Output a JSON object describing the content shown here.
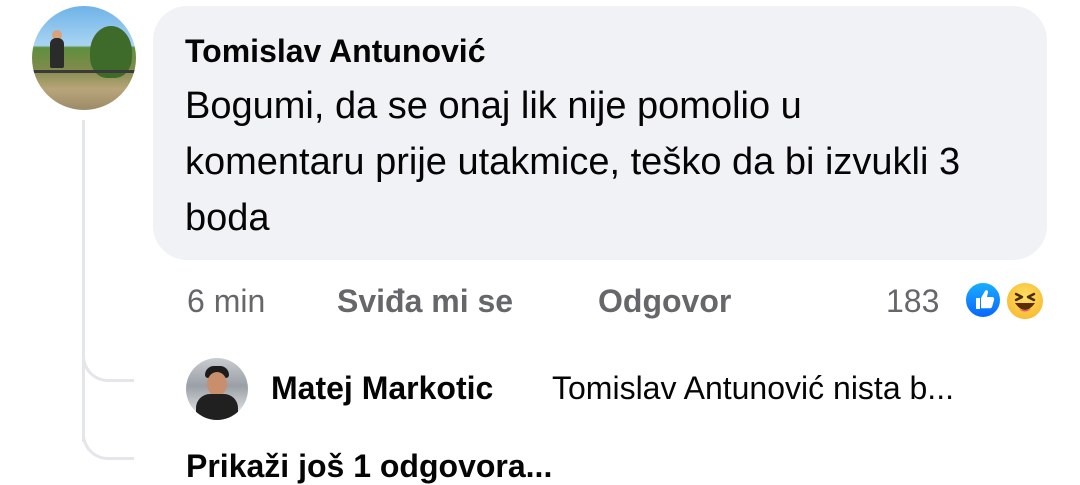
{
  "comment": {
    "author": "Tomislav Antunović",
    "text": "Bogumi, da se onaj lik nije pomolio u komentaru prije utakmice, teško da bi izvukli 3 boda",
    "time": "6 min",
    "like_label": "Sviđa mi se",
    "reply_label": "Odgovor",
    "reaction_count": "183",
    "reactions": [
      "like-icon",
      "haha-icon"
    ]
  },
  "reply": {
    "author": "Matej Markotic",
    "text": "Tomislav Antunović nista b..."
  },
  "more_replies_label": "Prikaži još 1 odgovora...",
  "colors": {
    "bubble": "#f0f2f5",
    "muted_text": "#65676b",
    "primary_text": "#050505",
    "like_blue": "#0866ff",
    "haha_yellow": "#f7b125"
  }
}
